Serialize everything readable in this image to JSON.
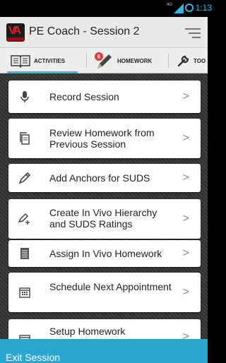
{
  "status_bar": {
    "network": "4G",
    "time": "1:13"
  },
  "app_bar": {
    "logo_text": "VA",
    "title": "PE Coach - Session 2"
  },
  "tabs": [
    {
      "label": "ACTIVITIES",
      "icon": "open-book-icon",
      "selected": true
    },
    {
      "label": "HOMEWORK",
      "icon": "pencil-icon",
      "badge": "6"
    },
    {
      "label": "TOO",
      "icon": "wrench-icon"
    }
  ],
  "activities": [
    {
      "label": "Record Session",
      "icon": "microphone-icon"
    },
    {
      "label": "Review Homework from Previous Session",
      "icon": "copy-icon"
    },
    {
      "label": "Add Anchors for SUDS",
      "icon": "pencil-icon"
    },
    {
      "label": "Create In Vivo Hierarchy and SUDS Ratings",
      "icon": "pencil-plus-icon"
    },
    {
      "label": "Assign In Vivo Homework",
      "icon": "list-icon"
    },
    {
      "label": "Schedule Next Appointment",
      "icon": "calendar-icon"
    },
    {
      "label": "Setup Homework",
      "icon": "calendar-icon"
    }
  ],
  "chevron": ">",
  "footer": {
    "exit_label": "Exit Session"
  },
  "colors": {
    "accent": "#33b5e5",
    "footer_bg": "#29a7cf",
    "badge": "#e53935"
  }
}
